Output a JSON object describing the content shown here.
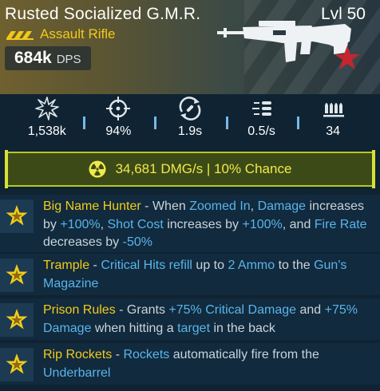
{
  "weapon": {
    "name": "Rusted Socialized G.M.R.",
    "level": "Lvl 50",
    "type": "Assault Rifle",
    "dps_value": "684k",
    "dps_unit": "DPS"
  },
  "stats": [
    {
      "icon": "damage-burst-icon",
      "value": "1,538k"
    },
    {
      "icon": "crosshair-icon",
      "value": "94%"
    },
    {
      "icon": "reload-icon",
      "value": "1.9s"
    },
    {
      "icon": "fire-rate-icon",
      "value": "0.5/s"
    },
    {
      "icon": "ammo-icon",
      "value": "34"
    }
  ],
  "element": {
    "icon": "radiation-icon",
    "text": "34,681 DMG/s | 10% Chance"
  },
  "perks": [
    {
      "name": "Big Name Hunter",
      "segments": [
        " - When ",
        "Zoomed In",
        ", ",
        "Damage",
        " increases by ",
        "+100%",
        ", ",
        "Shot Cost",
        " increases by ",
        "+100%",
        ", and ",
        "Fire Rate",
        " decreases by ",
        "-50%"
      ]
    },
    {
      "name": "Trample",
      "segments": [
        " - ",
        "Critical Hits refill",
        " up to ",
        "2 Ammo",
        " to the ",
        "Gun's Magazine"
      ]
    },
    {
      "name": "Prison Rules",
      "segments": [
        " - Grants ",
        "+75% Critical Damage",
        " and ",
        "+75% Damage",
        " when hitting a ",
        "target",
        " in the back"
      ]
    },
    {
      "name": "Rip Rockets",
      "segments": [
        " - ",
        "Rockets",
        " automatically fire from the ",
        "Underbarrel"
      ]
    }
  ],
  "colors": {
    "title_yellow": "#f2cc1b",
    "highlight_blue": "#5ab4ec",
    "element_border": "#b4c91e",
    "element_text": "#f0e94a",
    "background": "#0f2333"
  }
}
